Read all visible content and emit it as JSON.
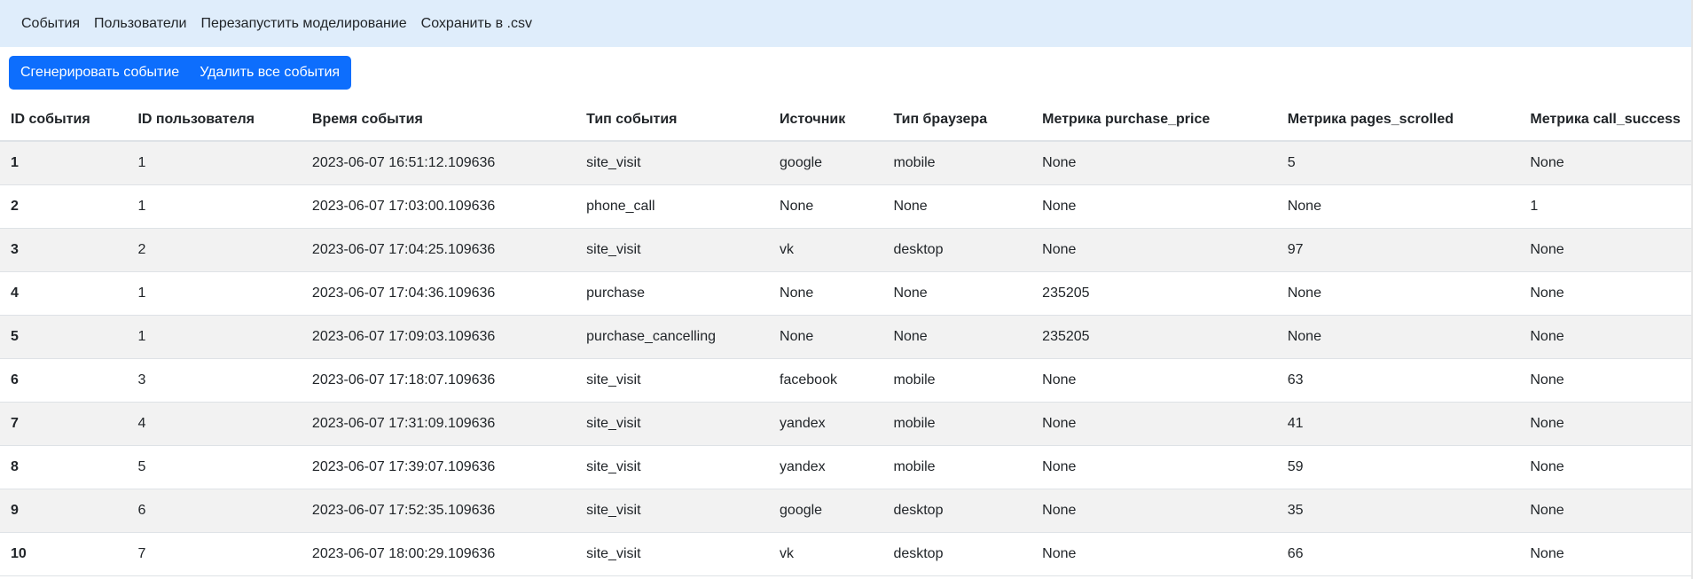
{
  "nav": {
    "items": [
      "События",
      "Пользователи",
      "Перезапустить моделирование",
      "Сохранить в .csv"
    ]
  },
  "toolbar": {
    "generate_label": "Сгенерировать событие",
    "delete_label": "Удалить все события"
  },
  "colors": {
    "navbar_bg": "#dfedfb",
    "primary": "#0d6efd",
    "stripe": "#f2f2f2"
  },
  "table": {
    "columns": [
      "ID события",
      "ID пользователя",
      "Время события",
      "Тип события",
      "Источник",
      "Тип браузера",
      "Метрика purchase_price",
      "Метрика pages_scrolled",
      "Метрика call_success"
    ],
    "rows": [
      [
        "1",
        "1",
        "2023-06-07 16:51:12.109636",
        "site_visit",
        "google",
        "mobile",
        "None",
        "5",
        "None"
      ],
      [
        "2",
        "1",
        "2023-06-07 17:03:00.109636",
        "phone_call",
        "None",
        "None",
        "None",
        "None",
        "1"
      ],
      [
        "3",
        "2",
        "2023-06-07 17:04:25.109636",
        "site_visit",
        "vk",
        "desktop",
        "None",
        "97",
        "None"
      ],
      [
        "4",
        "1",
        "2023-06-07 17:04:36.109636",
        "purchase",
        "None",
        "None",
        "235205",
        "None",
        "None"
      ],
      [
        "5",
        "1",
        "2023-06-07 17:09:03.109636",
        "purchase_cancelling",
        "None",
        "None",
        "235205",
        "None",
        "None"
      ],
      [
        "6",
        "3",
        "2023-06-07 17:18:07.109636",
        "site_visit",
        "facebook",
        "mobile",
        "None",
        "63",
        "None"
      ],
      [
        "7",
        "4",
        "2023-06-07 17:31:09.109636",
        "site_visit",
        "yandex",
        "mobile",
        "None",
        "41",
        "None"
      ],
      [
        "8",
        "5",
        "2023-06-07 17:39:07.109636",
        "site_visit",
        "yandex",
        "mobile",
        "None",
        "59",
        "None"
      ],
      [
        "9",
        "6",
        "2023-06-07 17:52:35.109636",
        "site_visit",
        "google",
        "desktop",
        "None",
        "35",
        "None"
      ],
      [
        "10",
        "7",
        "2023-06-07 18:00:29.109636",
        "site_visit",
        "vk",
        "desktop",
        "None",
        "66",
        "None"
      ]
    ]
  }
}
